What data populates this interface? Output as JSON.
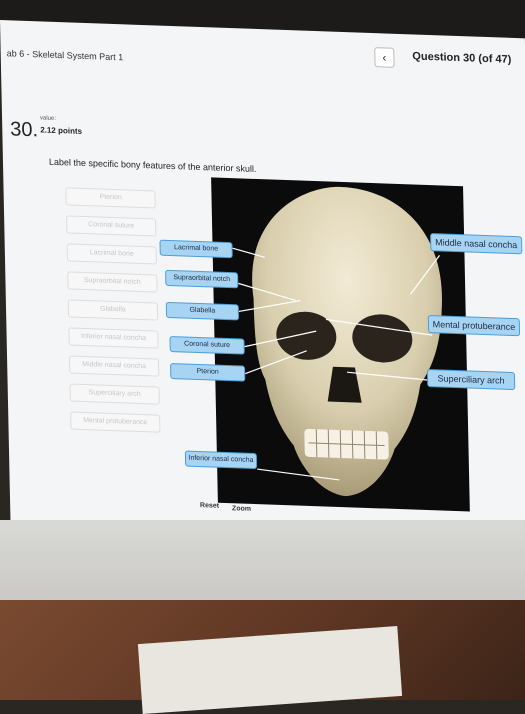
{
  "header": {
    "breadcrumb": "ab 6 - Skeletal System Part 1",
    "question_counter": "Question 30 (of 47)",
    "prev_icon": "chevron-left-icon"
  },
  "question": {
    "number": "30.",
    "value_label": "value:",
    "points": "2.12 points",
    "prompt": "Label the specific bony features of the anterior skull."
  },
  "label_bank": [
    "Pterion",
    "Coronal suture",
    "Lacrimal bone",
    "Supraorbital notch",
    "Glabella",
    "Inferior nasal concha",
    "Middle nasal concha",
    "Superciliary arch",
    "Mental protuberance"
  ],
  "placed_labels": {
    "lacrimal_bone": "Lacrimal bone",
    "supraorbital_notch": "Supraorbital notch",
    "glabella": "Glabella",
    "coronal_suture": "Coronal suture",
    "pterion": "Pterion",
    "inferior_nasal_concha": "Inferior nasal concha",
    "middle_nasal_concha": "Middle nasal concha",
    "mental_protuberance": "Mental protuberance",
    "superciliary_arch": "Superciliary arch"
  },
  "controls": {
    "reset": "Reset",
    "zoom": "Zoom"
  },
  "colors": {
    "label_fill": "#a8d4f3",
    "label_border": "#4a9ed8",
    "image_bg": "#0b0b0b"
  }
}
